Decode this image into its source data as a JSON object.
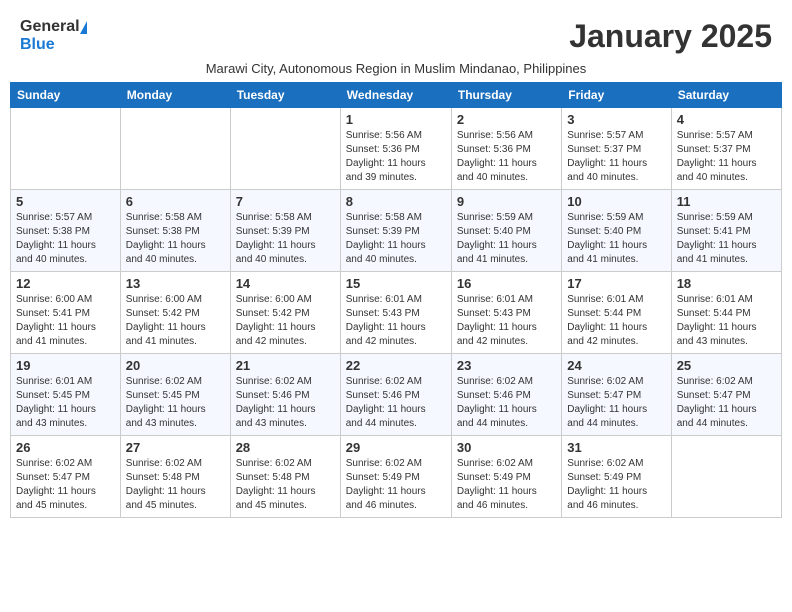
{
  "header": {
    "logo_general": "General",
    "logo_blue": "Blue",
    "month_year": "January 2025",
    "subtitle": "Marawi City, Autonomous Region in Muslim Mindanao, Philippines"
  },
  "days_of_week": [
    "Sunday",
    "Monday",
    "Tuesday",
    "Wednesday",
    "Thursday",
    "Friday",
    "Saturday"
  ],
  "weeks": [
    [
      {
        "day": "",
        "info": ""
      },
      {
        "day": "",
        "info": ""
      },
      {
        "day": "",
        "info": ""
      },
      {
        "day": "1",
        "info": "Sunrise: 5:56 AM\nSunset: 5:36 PM\nDaylight: 11 hours\nand 39 minutes."
      },
      {
        "day": "2",
        "info": "Sunrise: 5:56 AM\nSunset: 5:36 PM\nDaylight: 11 hours\nand 40 minutes."
      },
      {
        "day": "3",
        "info": "Sunrise: 5:57 AM\nSunset: 5:37 PM\nDaylight: 11 hours\nand 40 minutes."
      },
      {
        "day": "4",
        "info": "Sunrise: 5:57 AM\nSunset: 5:37 PM\nDaylight: 11 hours\nand 40 minutes."
      }
    ],
    [
      {
        "day": "5",
        "info": "Sunrise: 5:57 AM\nSunset: 5:38 PM\nDaylight: 11 hours\nand 40 minutes."
      },
      {
        "day": "6",
        "info": "Sunrise: 5:58 AM\nSunset: 5:38 PM\nDaylight: 11 hours\nand 40 minutes."
      },
      {
        "day": "7",
        "info": "Sunrise: 5:58 AM\nSunset: 5:39 PM\nDaylight: 11 hours\nand 40 minutes."
      },
      {
        "day": "8",
        "info": "Sunrise: 5:58 AM\nSunset: 5:39 PM\nDaylight: 11 hours\nand 40 minutes."
      },
      {
        "day": "9",
        "info": "Sunrise: 5:59 AM\nSunset: 5:40 PM\nDaylight: 11 hours\nand 41 minutes."
      },
      {
        "day": "10",
        "info": "Sunrise: 5:59 AM\nSunset: 5:40 PM\nDaylight: 11 hours\nand 41 minutes."
      },
      {
        "day": "11",
        "info": "Sunrise: 5:59 AM\nSunset: 5:41 PM\nDaylight: 11 hours\nand 41 minutes."
      }
    ],
    [
      {
        "day": "12",
        "info": "Sunrise: 6:00 AM\nSunset: 5:41 PM\nDaylight: 11 hours\nand 41 minutes."
      },
      {
        "day": "13",
        "info": "Sunrise: 6:00 AM\nSunset: 5:42 PM\nDaylight: 11 hours\nand 41 minutes."
      },
      {
        "day": "14",
        "info": "Sunrise: 6:00 AM\nSunset: 5:42 PM\nDaylight: 11 hours\nand 42 minutes."
      },
      {
        "day": "15",
        "info": "Sunrise: 6:01 AM\nSunset: 5:43 PM\nDaylight: 11 hours\nand 42 minutes."
      },
      {
        "day": "16",
        "info": "Sunrise: 6:01 AM\nSunset: 5:43 PM\nDaylight: 11 hours\nand 42 minutes."
      },
      {
        "day": "17",
        "info": "Sunrise: 6:01 AM\nSunset: 5:44 PM\nDaylight: 11 hours\nand 42 minutes."
      },
      {
        "day": "18",
        "info": "Sunrise: 6:01 AM\nSunset: 5:44 PM\nDaylight: 11 hours\nand 43 minutes."
      }
    ],
    [
      {
        "day": "19",
        "info": "Sunrise: 6:01 AM\nSunset: 5:45 PM\nDaylight: 11 hours\nand 43 minutes."
      },
      {
        "day": "20",
        "info": "Sunrise: 6:02 AM\nSunset: 5:45 PM\nDaylight: 11 hours\nand 43 minutes."
      },
      {
        "day": "21",
        "info": "Sunrise: 6:02 AM\nSunset: 5:46 PM\nDaylight: 11 hours\nand 43 minutes."
      },
      {
        "day": "22",
        "info": "Sunrise: 6:02 AM\nSunset: 5:46 PM\nDaylight: 11 hours\nand 44 minutes."
      },
      {
        "day": "23",
        "info": "Sunrise: 6:02 AM\nSunset: 5:46 PM\nDaylight: 11 hours\nand 44 minutes."
      },
      {
        "day": "24",
        "info": "Sunrise: 6:02 AM\nSunset: 5:47 PM\nDaylight: 11 hours\nand 44 minutes."
      },
      {
        "day": "25",
        "info": "Sunrise: 6:02 AM\nSunset: 5:47 PM\nDaylight: 11 hours\nand 44 minutes."
      }
    ],
    [
      {
        "day": "26",
        "info": "Sunrise: 6:02 AM\nSunset: 5:47 PM\nDaylight: 11 hours\nand 45 minutes."
      },
      {
        "day": "27",
        "info": "Sunrise: 6:02 AM\nSunset: 5:48 PM\nDaylight: 11 hours\nand 45 minutes."
      },
      {
        "day": "28",
        "info": "Sunrise: 6:02 AM\nSunset: 5:48 PM\nDaylight: 11 hours\nand 45 minutes."
      },
      {
        "day": "29",
        "info": "Sunrise: 6:02 AM\nSunset: 5:49 PM\nDaylight: 11 hours\nand 46 minutes."
      },
      {
        "day": "30",
        "info": "Sunrise: 6:02 AM\nSunset: 5:49 PM\nDaylight: 11 hours\nand 46 minutes."
      },
      {
        "day": "31",
        "info": "Sunrise: 6:02 AM\nSunset: 5:49 PM\nDaylight: 11 hours\nand 46 minutes."
      },
      {
        "day": "",
        "info": ""
      }
    ]
  ]
}
